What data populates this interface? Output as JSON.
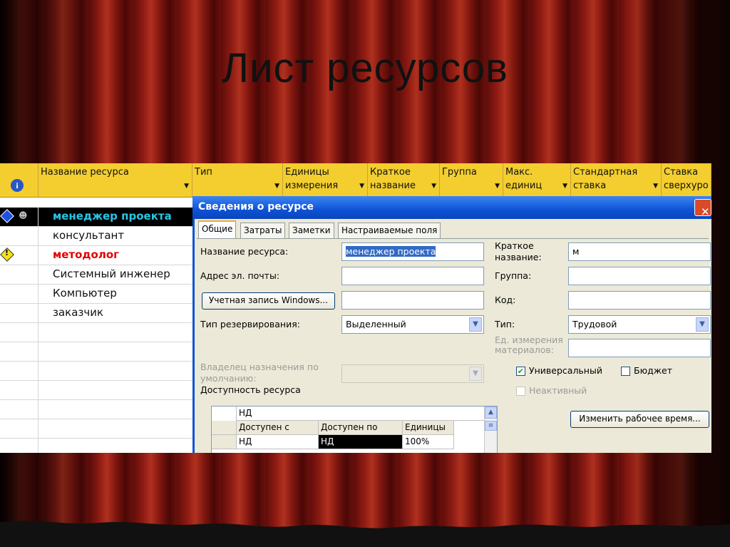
{
  "slide": {
    "title": "Лист ресурсов"
  },
  "sheet": {
    "headers": [
      "Название ресурса",
      "Тип",
      "Единицы измерения",
      "Краткое название",
      "Группа",
      "Макс. единиц",
      "Стандартная ставка",
      "Ставка сверхуро"
    ],
    "rows": [
      {
        "name": "менеджер проекта",
        "selected": true,
        "icons": "diamond-info"
      },
      {
        "name": "консультант"
      },
      {
        "name": "методолог",
        "overallocated": true
      },
      {
        "name": "Системный инженер"
      },
      {
        "name": "Компьютер"
      },
      {
        "name": "заказчик"
      }
    ]
  },
  "dialog": {
    "title": "Сведения о ресурсе",
    "close": "✕",
    "tabs": [
      "Общие",
      "Затраты",
      "Заметки",
      "Настраиваемые поля"
    ],
    "active_tab": "Общие",
    "fields": {
      "name_label": "Название ресурса:",
      "name_value": "менеджер проекта",
      "email_label": "Адрес эл. почты:",
      "email_value": "",
      "windows_button": "Учетная запись Windows...",
      "windows_value": "",
      "booking_label": "Тип резервирования:",
      "booking_value": "Выделенный",
      "owner_label": "Владелец назначения по умолчанию:",
      "owner_value": "",
      "availability_label": "Доступность ресурса",
      "short_label": "Краткое название:",
      "short_value": "м",
      "group_label": "Группа:",
      "group_value": "",
      "code_label": "Код:",
      "code_value": "",
      "type_label": "Тип:",
      "type_value": "Трудовой",
      "material_label": "Ед. измерения материалов:",
      "material_value": "",
      "generic_label": "Универсальный",
      "generic_checked": true,
      "budget_label": "Бюджет",
      "budget_checked": false,
      "inactive_label": "Неактивный",
      "inactive_checked": false,
      "change_button": "Изменить рабочее время..."
    },
    "availability": {
      "edit_value": "НД",
      "headers": [
        "Доступен с",
        "Доступен по",
        "Единицы"
      ],
      "row": [
        "НД",
        "НД",
        "100%"
      ]
    }
  }
}
